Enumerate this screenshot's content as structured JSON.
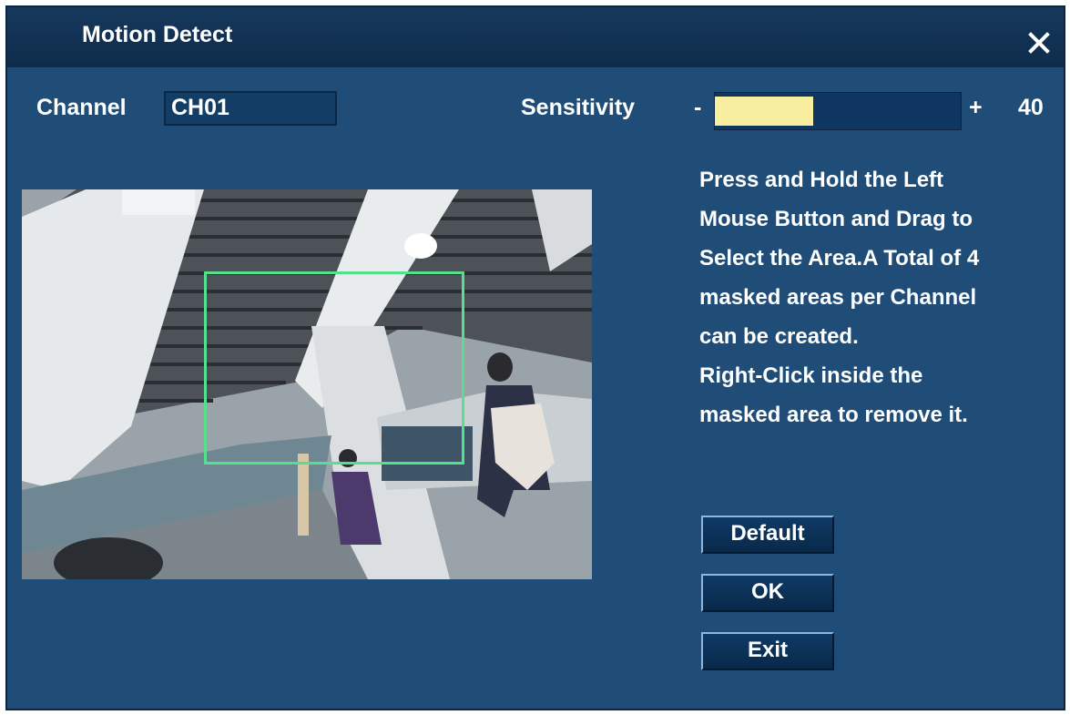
{
  "window": {
    "title": "Motion Detect",
    "close_icon": "close-icon"
  },
  "channel": {
    "label": "Channel",
    "value": "CH01"
  },
  "sensitivity": {
    "label": "Sensitivity",
    "minus": "-",
    "plus": "+",
    "value": "40",
    "level_fraction": 0.4
  },
  "help": {
    "lines": [
      "Press and Hold the Left",
      "Mouse Button and Drag to",
      "Select the Area.A Total of 4",
      "masked areas per Channel",
      "can be created.",
      "Right-Click inside the",
      "masked area to remove it."
    ]
  },
  "buttons": {
    "default": "Default",
    "ok": "OK",
    "exit": "Exit"
  },
  "colors": {
    "panel": "#1f4d78",
    "titlebar": "#15385c",
    "slider_fill": "#f8eea0",
    "mask_outline": "#54e08c"
  }
}
